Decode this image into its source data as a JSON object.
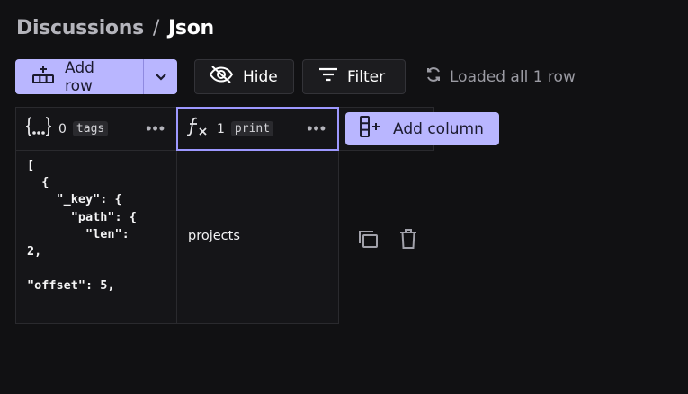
{
  "breadcrumb": {
    "parent": "Discussions",
    "separator": "/",
    "current": "Json"
  },
  "toolbar": {
    "add_row_label": "Add row",
    "hide_label": "Hide",
    "filter_label": "Filter",
    "status_text": "Loaded all 1 row"
  },
  "columns": [
    {
      "index": "0",
      "name": "tags",
      "type_icon": "json-braces-icon"
    },
    {
      "index": "1",
      "name": "print",
      "type_icon": "formula-icon"
    }
  ],
  "add_column_label": "Add column",
  "rows": [
    {
      "tags": "[\n  {\n    \"_key\": {\n      \"path\": {\n        \"len\":\n2,\n\n\"offset\": 5,",
      "print": "projects"
    }
  ],
  "colors": {
    "accent": "#b9b6ff",
    "background": "#111113"
  }
}
